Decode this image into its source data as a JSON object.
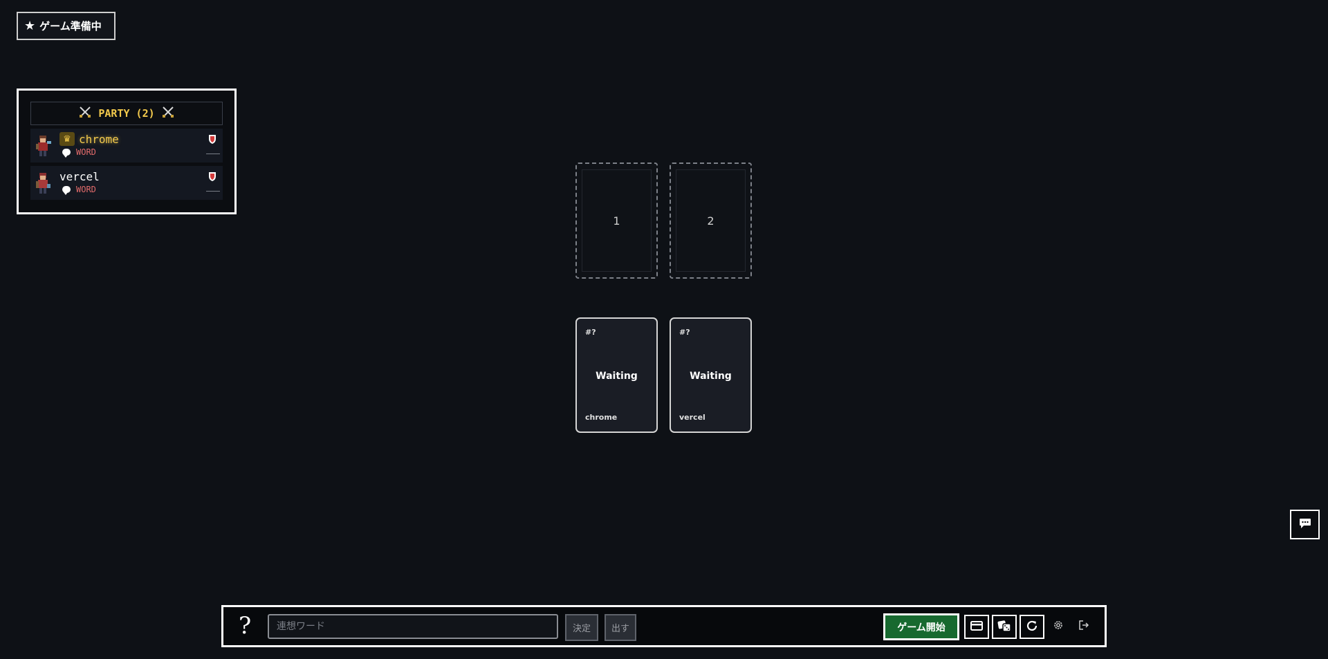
{
  "status": {
    "icon": "star-icon",
    "star_glyph": "★",
    "label": "ゲーム準備中"
  },
  "party": {
    "title": "PARTY (2)",
    "icon": "crossed-swords-icon",
    "players": [
      {
        "name": "chrome",
        "is_host": true,
        "word_label": "WORD"
      },
      {
        "name": "vercel",
        "is_host": false,
        "word_label": "WORD"
      }
    ]
  },
  "slots": [
    {
      "number": "1"
    },
    {
      "number": "2"
    }
  ],
  "cards": [
    {
      "id": "#?",
      "status": "Waiting",
      "owner": "chrome"
    },
    {
      "id": "#?",
      "status": "Waiting",
      "owner": "vercel"
    }
  ],
  "toolbar": {
    "help_label": "?",
    "word_input_placeholder": "連想ワード",
    "decide_label": "決定",
    "submit_label": "出す",
    "start_label": "ゲーム開始"
  },
  "colors": {
    "background": "#0e1116",
    "host_name": "#f2c94c",
    "word_label": "#e36b6b",
    "start_button": "#17692f"
  }
}
